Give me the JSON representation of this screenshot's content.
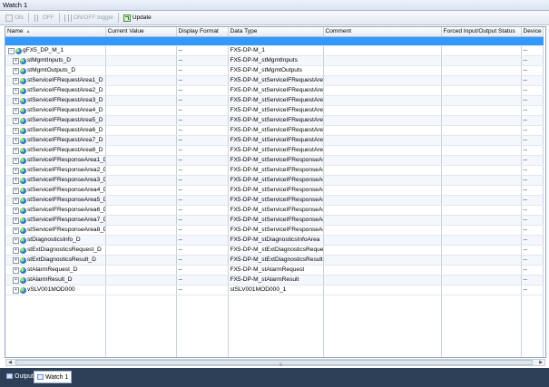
{
  "window": {
    "title": "Watch 1"
  },
  "toolbar": {
    "on_label": "ON",
    "off_label": "OFF",
    "toggle_label": "ON/OFF toggle",
    "update_label": "Update"
  },
  "columns": [
    "Name",
    "Current Value",
    "Display Format",
    "Data Type",
    "Comment",
    "Forced Input/Output Status",
    "Device"
  ],
  "root": {
    "name": "gFX5_DP_M_1",
    "format": "--",
    "type": "FX5-DP-M_1",
    "device": "--"
  },
  "rows": [
    {
      "name": "stMgmtInputs_D",
      "format": "--",
      "type": "FX5-DP-M_stMgmtInputs",
      "device": "--"
    },
    {
      "name": "stMgmtOutputs_D",
      "format": "--",
      "type": "FX5-DP-M_stMgmtOutputs",
      "device": "--"
    },
    {
      "name": "stServiceIFRequestArea1_D",
      "format": "--",
      "type": "FX5-DP-M_stServiceIFRequestArea",
      "device": "--"
    },
    {
      "name": "stServiceIFRequestArea2_D",
      "format": "--",
      "type": "FX5-DP-M_stServiceIFRequestArea",
      "device": "--"
    },
    {
      "name": "stServiceIFRequestArea3_D",
      "format": "--",
      "type": "FX5-DP-M_stServiceIFRequestArea",
      "device": "--"
    },
    {
      "name": "stServiceIFRequestArea4_D",
      "format": "--",
      "type": "FX5-DP-M_stServiceIFRequestArea",
      "device": "--"
    },
    {
      "name": "stServiceIFRequestArea5_D",
      "format": "--",
      "type": "FX5-DP-M_stServiceIFRequestArea",
      "device": "--"
    },
    {
      "name": "stServiceIFRequestArea6_D",
      "format": "--",
      "type": "FX5-DP-M_stServiceIFRequestArea",
      "device": "--"
    },
    {
      "name": "stServiceIFRequestArea7_D",
      "format": "--",
      "type": "FX5-DP-M_stServiceIFRequestArea",
      "device": "--"
    },
    {
      "name": "stServiceIFRequestArea8_D",
      "format": "--",
      "type": "FX5-DP-M_stServiceIFRequestArea",
      "device": "--"
    },
    {
      "name": "stServiceIFResponseArea1_D",
      "format": "--",
      "type": "FX5-DP-M_stServiceIFResponseArea",
      "device": "--"
    },
    {
      "name": "stServiceIFResponseArea2_D",
      "format": "--",
      "type": "FX5-DP-M_stServiceIFResponseArea",
      "device": "--"
    },
    {
      "name": "stServiceIFResponseArea3_D",
      "format": "--",
      "type": "FX5-DP-M_stServiceIFResponseArea",
      "device": "--"
    },
    {
      "name": "stServiceIFResponseArea4_D",
      "format": "--",
      "type": "FX5-DP-M_stServiceIFResponseArea",
      "device": "--"
    },
    {
      "name": "stServiceIFResponseArea5_D",
      "format": "--",
      "type": "FX5-DP-M_stServiceIFResponseArea",
      "device": "--"
    },
    {
      "name": "stServiceIFResponseArea6_D",
      "format": "--",
      "type": "FX5-DP-M_stServiceIFResponseArea",
      "device": "--"
    },
    {
      "name": "stServiceIFResponseArea7_D",
      "format": "--",
      "type": "FX5-DP-M_stServiceIFResponseArea",
      "device": "--"
    },
    {
      "name": "stServiceIFResponseArea8_D",
      "format": "--",
      "type": "FX5-DP-M_stServiceIFResponseArea",
      "device": "--"
    },
    {
      "name": "stDiagnosticsInfo_D",
      "format": "--",
      "type": "FX5-DP-M_stDiagnosticsInfoArea",
      "device": "--"
    },
    {
      "name": "stExtDiagnosticsRequest_D",
      "format": "--",
      "type": "FX5-DP-M_stExtDiagnosticsRequest",
      "device": "--"
    },
    {
      "name": "stExtDiagnosticsResult_D",
      "format": "--",
      "type": "FX5-DP-M_stExtDiagnosticsResult",
      "device": "--"
    },
    {
      "name": "stAlarmRequest_D",
      "format": "--",
      "type": "FX5-DP-M_stAlarmRequest",
      "device": "--"
    },
    {
      "name": "stAlarmResult_D",
      "format": "--",
      "type": "FX5-DP-M_stAlarmResult",
      "device": "--"
    },
    {
      "name": "vSLV001MOD000",
      "format": "--",
      "type": "stSLV001MOD000_1",
      "device": "--"
    }
  ],
  "bottom_tabs": [
    {
      "label": "Output"
    },
    {
      "label": "Watch 1"
    }
  ],
  "colors": {
    "selection": "#3399ff",
    "bottom_bar": "#2d3e57"
  }
}
